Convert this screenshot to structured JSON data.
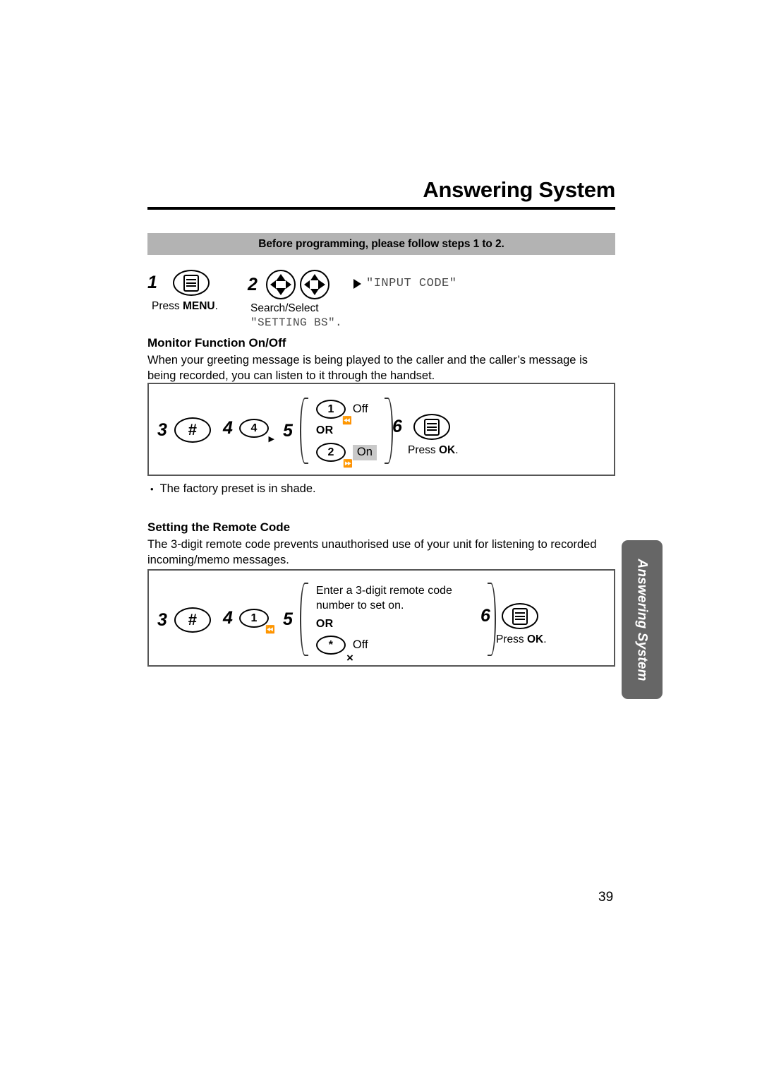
{
  "header": {
    "title": "Answering System"
  },
  "notice": {
    "text": "Before programming, please follow steps 1 to 2."
  },
  "top_steps": [
    {
      "number": "1",
      "icon": "menu-key-icon",
      "caption_prefix": "Press ",
      "caption_bold": "MENU",
      "caption_suffix": "."
    },
    {
      "number": "2",
      "icon": "navigator-keys-icon",
      "caption_line1": "Search/Select",
      "caption_line2": "\"SETTING BS\"."
    }
  ],
  "display_hint": {
    "arrow": "right-arrow-marker",
    "text": "\"INPUT CODE\""
  },
  "sections": [
    {
      "heading": "Monitor Function On/Off",
      "body": "When your greeting message is being played to the caller and the caller’s message is being recorded, you can listen to it through the handset.",
      "diagram": {
        "steps": [
          {
            "number": "3",
            "key": "#",
            "sub": ""
          },
          {
            "number": "4",
            "key": "4",
            "sub": "play-triangle"
          },
          {
            "number": "5",
            "key": "",
            "sub": ""
          },
          {
            "number": "6",
            "key": "menu",
            "sub": ""
          }
        ],
        "options": [
          {
            "key": "1",
            "sub": "rewind",
            "label": "Off",
            "shaded": false
          },
          {
            "key": "2",
            "sub": "play",
            "label": "On",
            "shaded": true
          }
        ],
        "or_label": "OR",
        "final_caption_prefix": "Press ",
        "final_caption_bold": "OK",
        "final_caption_suffix": "."
      },
      "note": {
        "bullet": "•",
        "text": "The factory preset is in shade."
      }
    },
    {
      "heading": "Setting the Remote Code",
      "body": "The 3-digit remote code prevents unauthorised use of your unit for listening to recorded incoming/memo messages.",
      "diagram": {
        "steps": [
          {
            "number": "3",
            "key": "#",
            "sub": ""
          },
          {
            "number": "4",
            "key": "1",
            "sub": "rewind"
          },
          {
            "number": "5",
            "key": "",
            "sub": ""
          },
          {
            "number": "6",
            "key": "menu",
            "sub": ""
          }
        ],
        "instruction": "Enter a 3-digit remote code number to set on.",
        "or_label": "OR",
        "options": [
          {
            "key": "*",
            "sub": "x",
            "label": "Off",
            "shaded": false
          }
        ],
        "final_caption_prefix": "Press ",
        "final_caption_bold": "OK",
        "final_caption_suffix": "."
      }
    }
  ],
  "side_tab": {
    "label": "Answering System"
  },
  "page_number": "39",
  "colors": {
    "banner_grey": "#b3b3b3",
    "shade_grey": "#c9c9c9",
    "side_tab_grey": "#666666",
    "lcd_text": "#4a4a4a"
  }
}
